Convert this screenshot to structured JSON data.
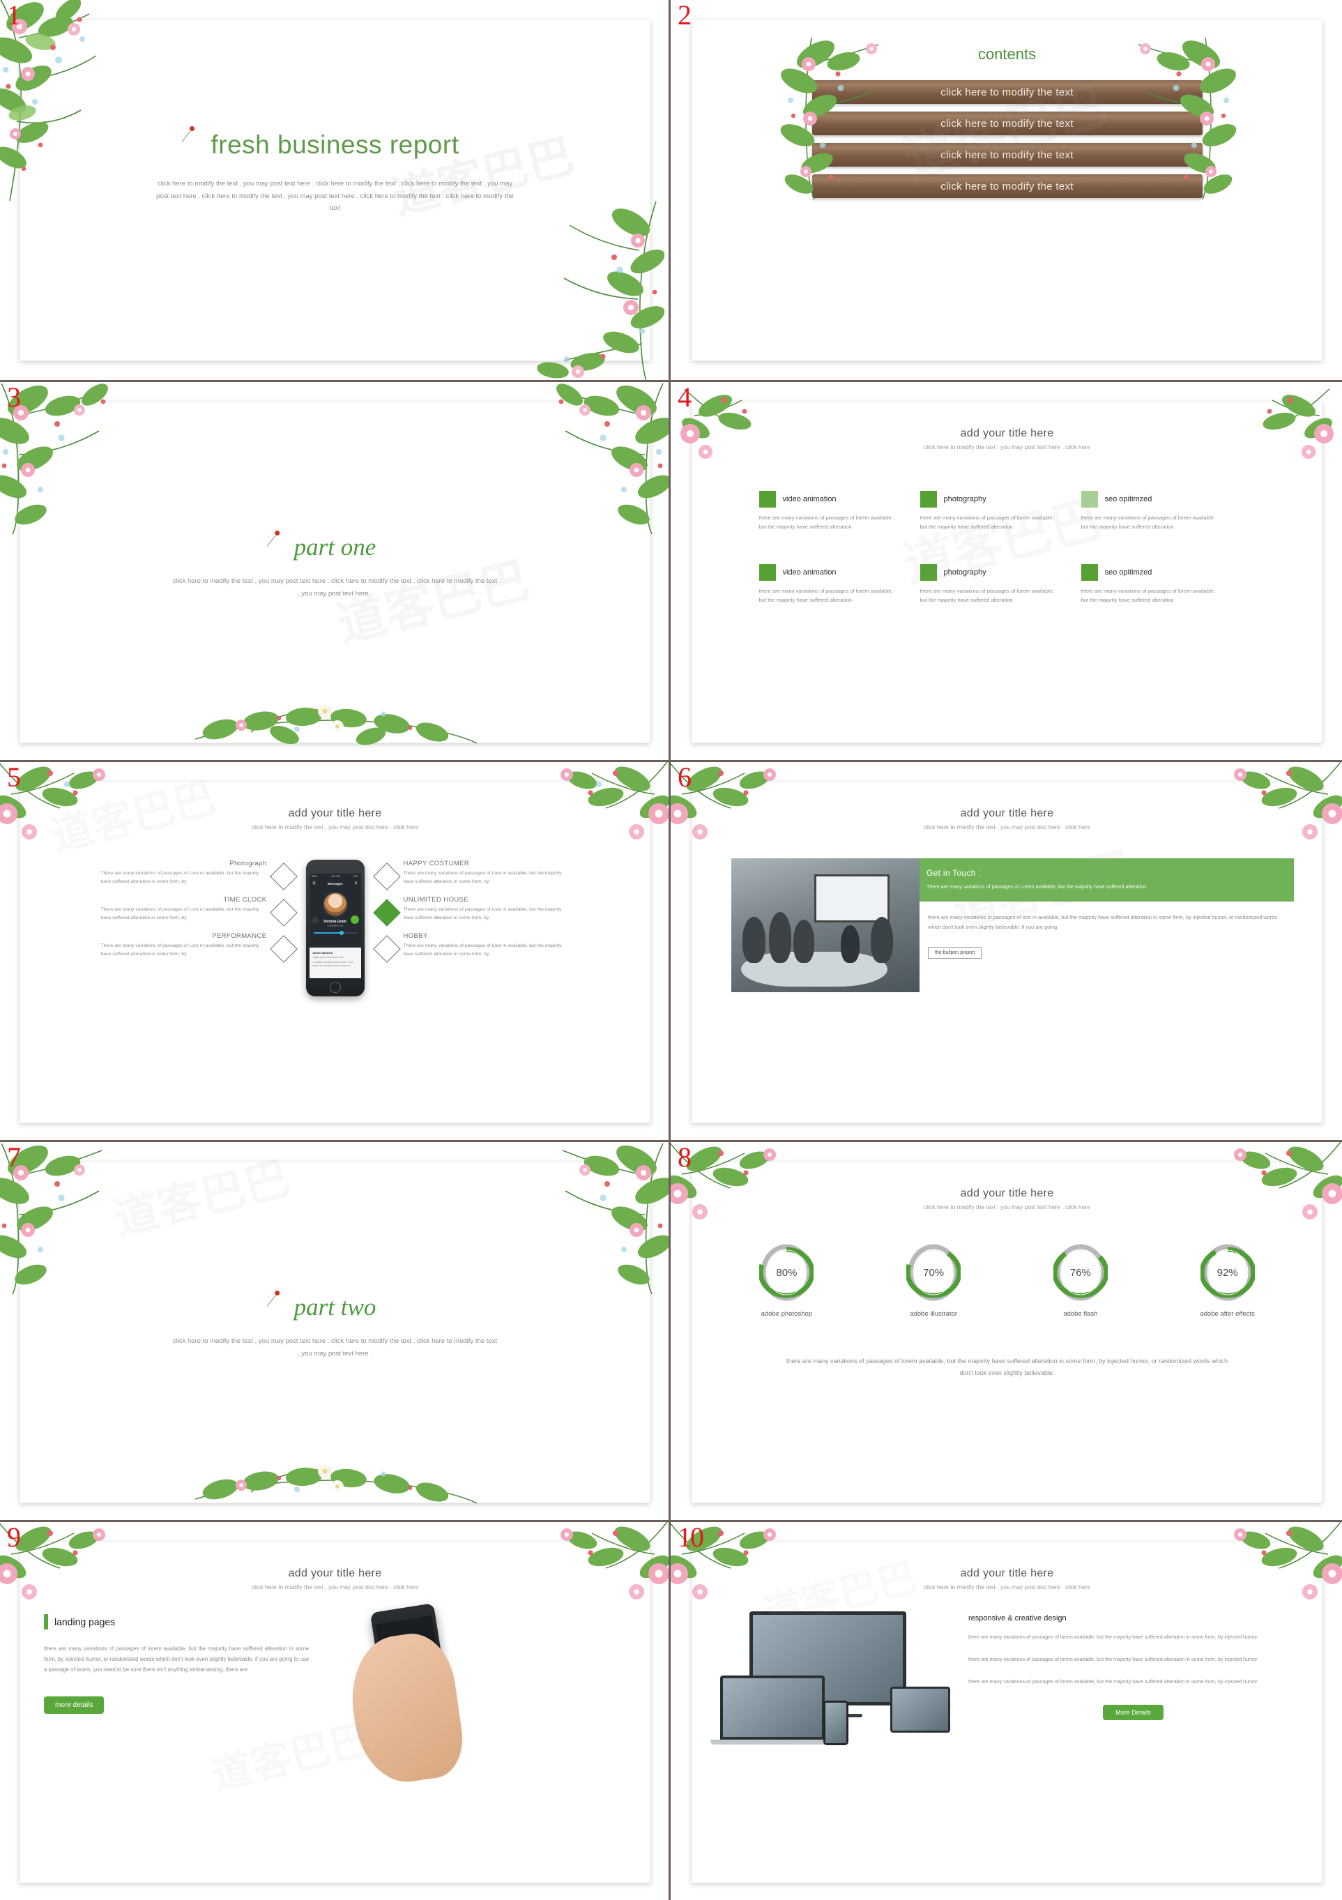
{
  "deck": {
    "slides": [
      {
        "number": "1",
        "title": "fresh business report",
        "body": "click here to modify the text , you may post text here . click here to modify the text . click here to modify the text , you may post text here . click here to modify the text , you may post text here . click here to modify the text . click here to modify the text"
      },
      {
        "number": "2",
        "title": "contents",
        "items": [
          "click here to modify the text",
          "click here to modify the text",
          "click here to modify the text",
          "click here to modify the text"
        ]
      },
      {
        "number": "3",
        "title": "part one",
        "body": "click here to modify the text , you may post text here . click here to modify the text . click here to modify the text , you may post text here ."
      },
      {
        "number": "4",
        "title": "add your title here",
        "subtitle": "click here to modify the text , you may post text here . click here",
        "features": [
          {
            "name": "video animation",
            "body": "there are many variations of passages of lorem available, but the majority have suffered alteration"
          },
          {
            "name": "photography",
            "body": "there are many variations of passages of lorem available, but the majority have suffered alteration"
          },
          {
            "name": "seo opitimzed",
            "body": "there are many variations of passages of lorem available, but the majority have suffered alteration"
          },
          {
            "name": "video animation",
            "body": "there are many variations of passages of lorem available, but the majority have suffered alteration"
          },
          {
            "name": "photography",
            "body": "there are many variations of passages of lorem available, but the majority have suffered alteration"
          },
          {
            "name": "seo opitimzed",
            "body": "there are many variations of passages of lorem available, but the majority have suffered alteration"
          }
        ]
      },
      {
        "number": "5",
        "title": "add your title here",
        "subtitle": "click here to modify the text , you may post text here . click here",
        "left_items": [
          {
            "heading": "Photograph",
            "body": "There are many variations of passages of Lore m available, but the majority have suffered alteration in some form, by"
          },
          {
            "heading": "TIME CLOCK",
            "body": "There are many variations of passages of Lore m available, but the majority have suffered alteration in some form, by"
          },
          {
            "heading": "PERFORMANCE",
            "body": "There are many variations of passages of Lore m available, but the majority have suffered alteration in some form, by"
          }
        ],
        "right_items": [
          {
            "heading": "HAPPY COSTUMER",
            "body": "There are many variations of passages of Lore m available, but the majority have suffered alteration in some form, by"
          },
          {
            "heading": "UNLIMITED HOUSE",
            "body": "There are many variations of passages of Lore m available, but the majority have suffered alteration in some form, by"
          },
          {
            "heading": "HOBBY",
            "body": "There are many variations of passages of Lore m available, but the majority have suffered alteration in some form, by"
          }
        ],
        "phone": {
          "carrier": "BELL",
          "time": "4:21 PM",
          "battery": "22%",
          "nav_title": "Messages",
          "contact_name": "Victoria Grant",
          "contact_number": "+15145607311",
          "card_title": "Daniel Sandvik",
          "card_subtitle": "Ligula Quam Vestibulum Sem",
          "card_body": "Curabitur blandit tempus porttitor. Cras mattis consectetur purus sit amet at ..."
        }
      },
      {
        "number": "6",
        "title": "add your title here",
        "subtitle": "click here to modify the text , you may post text here . click here",
        "band_title": "Get in Touch :",
        "band_body": "There are many variations of passages of Lorem available, but the majority have suffered alteration",
        "body": "there are many variations of passages of lore m available, but the majority have suffered alteration in some form, by injected humor, or randomized words which don't look even slightly believable. if you are going",
        "button": "the bullpen project"
      },
      {
        "number": "7",
        "title": "part two",
        "body": "click here to modify the text , you may post text here . click here to modify the text . click here to modify the text , you may post text here ."
      },
      {
        "number": "8",
        "title": "add your title here",
        "subtitle": "click here to modify the text , you may post text here . click here",
        "footer": "there are many variations of passages of lorem available, but the majority have suffered alteration in some form, by injected humor, or randomized words which don't look even slightly believable."
      },
      {
        "number": "9",
        "title": "add your title here",
        "subtitle": "click here to modify the text , you may post text here . click here",
        "section_title": "landing pages",
        "body": "there are many variations of passages of lorem available, but the majority have suffered alteration in some form, by injected humor, or randomized words which don't look even slightly believable. if you are going to use a passage of lorem, you need to be sure there isn't anything embarrassing. there are",
        "button": "more details"
      },
      {
        "number": "10",
        "title": "add your title here",
        "subtitle": "click here to modify the text , you may post text here . click here",
        "section_title": "responsive & creative design",
        "paragraphs": [
          "there are many variations of passages of lorem available, but the majority have suffered alteration in some form, by injected humor",
          "there are many variations of passages of lorem available, but the majority have suffered alteration in some form, by injected humor",
          "there are many variations of passages of lorem available, but the majority have suffered alteration in some form, by injected humor"
        ],
        "button": "More Details"
      }
    ]
  },
  "chart_data": {
    "type": "pie",
    "title": "add your title here",
    "subtitle": "click here to modify the text , you may post text here . click here",
    "categories": [
      "adobe photoshop",
      "adobe illustrator",
      "adobe flash",
      "adobe after effects"
    ],
    "values": [
      80,
      70,
      76,
      92
    ],
    "labels": [
      "80%",
      "70%",
      "76%",
      "92%"
    ],
    "unit": "%",
    "ylim": [
      0,
      100
    ],
    "grid": false,
    "legend": "none",
    "colors": {
      "fill": "#4e9e35",
      "track": "#b8b8b8"
    },
    "footer": "there are many variations of passages of lorem available, but the majority have suffered alteration in some form, by injected humor, or randomized words which don't look even slightly believable."
  },
  "watermarks": [
    "道客巴巴",
    "道客巴巴",
    "道客巴巴",
    "道客巴巴",
    "道客巴巴"
  ],
  "colors": {
    "green": "#5aa83c",
    "green_dark": "#4e9e35",
    "green_title": "#5e9a49",
    "wood": "#7d5c45",
    "red_number": "#e8151b",
    "divider": "#6b5f5c"
  }
}
